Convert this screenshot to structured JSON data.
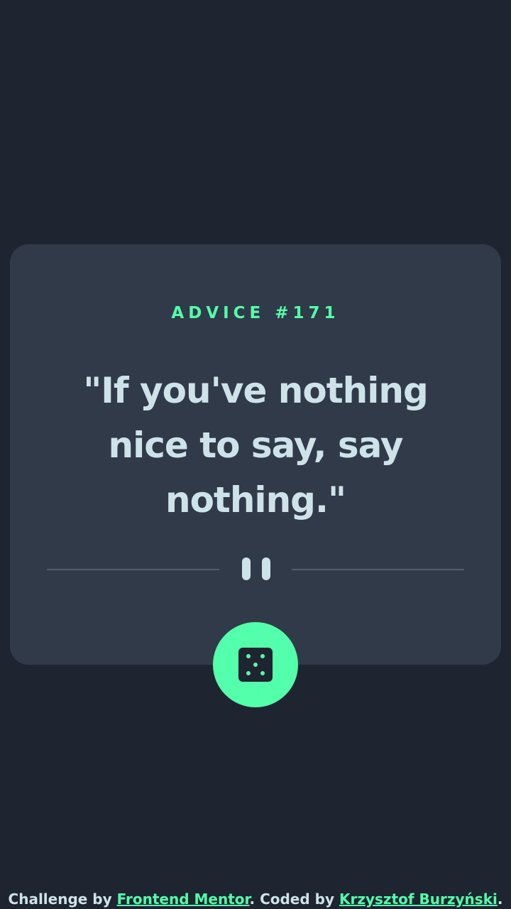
{
  "advice": {
    "id_label": "ADVICE #171",
    "quote": "\"If you've nothing nice to say, say nothing.\""
  },
  "icons": {
    "divider": "pause-icon",
    "button": "dice-icon"
  },
  "colors": {
    "background": "#1f2431",
    "card": "#313a48",
    "accent": "#53ffaa",
    "text": "#cee3e9",
    "divider": "#4f5d74"
  },
  "attribution": {
    "prefix": "Challenge by ",
    "link1": "Frontend Mentor",
    "middle": ". Coded by ",
    "link2": "Krzysztof Burzyński",
    "suffix": "."
  }
}
